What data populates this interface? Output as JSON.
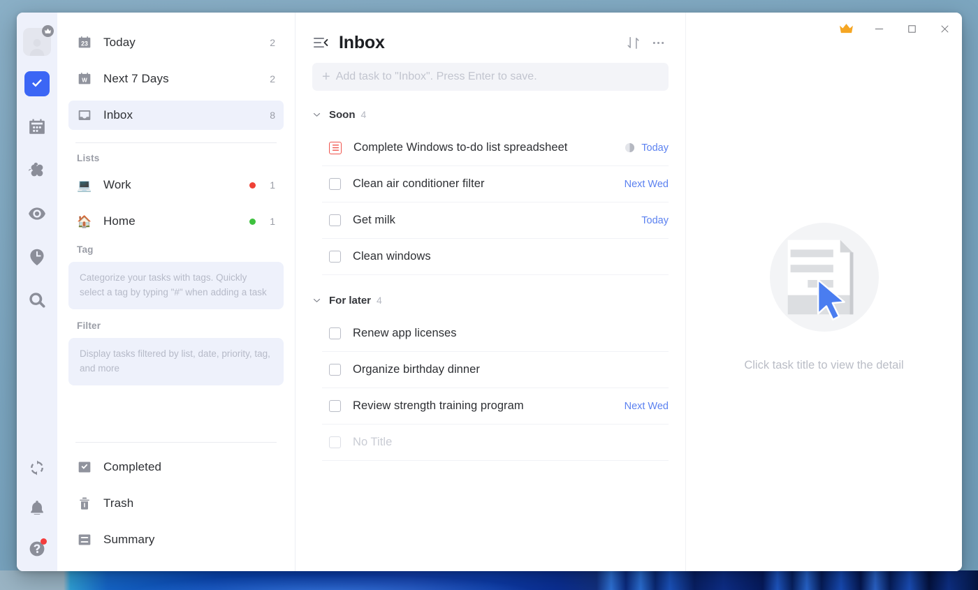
{
  "window": {
    "titlebar": {
      "crown_label": "Premium",
      "minimize_label": "Minimize",
      "maximize_label": "Maximize",
      "close_label": "Close"
    }
  },
  "rail": {
    "avatar_name": "user-avatar",
    "items": [
      {
        "name": "tasks",
        "icon": "check-square-icon",
        "active": true
      },
      {
        "name": "calendar",
        "icon": "calendar-icon",
        "active": false
      },
      {
        "name": "matrix",
        "icon": "four-squares-icon",
        "active": false
      },
      {
        "name": "focus",
        "icon": "target-eye-icon",
        "active": false
      },
      {
        "name": "pomodoro",
        "icon": "clock-pin-icon",
        "active": false
      },
      {
        "name": "search",
        "icon": "search-icon",
        "active": false
      }
    ],
    "bottom_items": [
      {
        "name": "sync",
        "icon": "sync-icon"
      },
      {
        "name": "notifications",
        "icon": "bell-icon"
      },
      {
        "name": "help",
        "icon": "help-icon",
        "badge": true
      }
    ]
  },
  "sidebar": {
    "smart_lists": [
      {
        "label": "Today",
        "count": "2",
        "icon": "calendar-23-icon",
        "selected": false
      },
      {
        "label": "Next 7 Days",
        "count": "2",
        "icon": "calendar-week-icon",
        "selected": false
      },
      {
        "label": "Inbox",
        "count": "8",
        "icon": "inbox-icon",
        "selected": true
      }
    ],
    "lists_header": "Lists",
    "lists": [
      {
        "label": "Work",
        "count": "1",
        "emoji": "💻",
        "dot_color": "#ef4136"
      },
      {
        "label": "Home",
        "count": "1",
        "emoji": "🏠",
        "dot_color": "#3ec13e"
      }
    ],
    "tag_header": "Tag",
    "tag_hint": "Categorize your tasks with tags. Quickly select a tag by typing \"#\" when adding a task",
    "filter_header": "Filter",
    "filter_hint": "Display tasks filtered by list, date, priority, tag, and more",
    "bottom_items": [
      {
        "label": "Completed",
        "icon": "checked-box-icon"
      },
      {
        "label": "Trash",
        "icon": "trash-icon"
      },
      {
        "label": "Summary",
        "icon": "summary-icon"
      }
    ]
  },
  "main": {
    "collapse_icon": "collapse-sidebar-icon",
    "title": "Inbox",
    "sort_icon": "sort-icon",
    "more_icon": "more-horizontal-icon",
    "add_task_placeholder": "Add task to \"Inbox\". Press Enter to save.",
    "add_task_value": "",
    "groups": [
      {
        "name": "Soon",
        "count": "4",
        "tasks": [
          {
            "title": "Complete Windows to-do list spreadsheet",
            "due": "Today",
            "icon": "note-icon",
            "progress": true,
            "empty": false
          },
          {
            "title": "Clean air conditioner filter",
            "due": "Next Wed",
            "icon": "checkbox",
            "progress": false,
            "empty": false
          },
          {
            "title": "Get milk",
            "due": "Today",
            "icon": "checkbox",
            "progress": false,
            "empty": false
          },
          {
            "title": "Clean windows",
            "due": "",
            "icon": "checkbox",
            "progress": false,
            "empty": false
          }
        ]
      },
      {
        "name": "For later",
        "count": "4",
        "tasks": [
          {
            "title": "Renew app licenses",
            "due": "",
            "icon": "checkbox",
            "progress": false,
            "empty": false
          },
          {
            "title": "Organize birthday dinner",
            "due": "",
            "icon": "checkbox",
            "progress": false,
            "empty": false
          },
          {
            "title": "Review strength training program",
            "due": "Next Wed",
            "icon": "checkbox",
            "progress": false,
            "empty": false
          },
          {
            "title": "No Title",
            "due": "",
            "icon": "checkbox",
            "progress": false,
            "empty": true
          }
        ]
      }
    ]
  },
  "detail": {
    "empty_illustration": "document-cursor-icon",
    "empty_text": "Click task title to view the detail"
  },
  "colors": {
    "accent": "#3b66f5",
    "due_link": "#5b81f0",
    "rail_bg": "#eef1fb",
    "selected_bg": "#eef1fb",
    "note_red": "#f0544d",
    "crown_gold": "#f5a623"
  }
}
